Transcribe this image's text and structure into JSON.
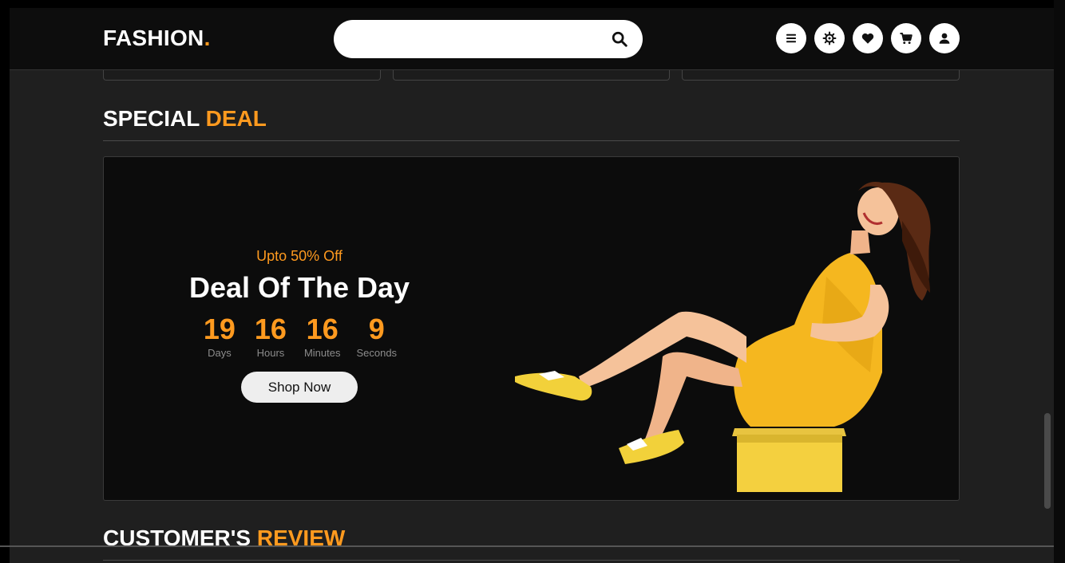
{
  "header": {
    "logo_text": "FASHION",
    "logo_dot": ".",
    "search_placeholder": "",
    "icons": [
      "menu-icon",
      "settings-icon",
      "heart-icon",
      "cart-icon",
      "user-icon"
    ]
  },
  "special_deal": {
    "title_main": "SPECIAL",
    "title_accent": "DEAL",
    "offer_text": "Upto 50% Off",
    "deal_title": "Deal Of The Day",
    "countdown": [
      {
        "value": "19",
        "label": "Days"
      },
      {
        "value": "16",
        "label": "Hours"
      },
      {
        "value": "16",
        "label": "Minutes"
      },
      {
        "value": "9",
        "label": "Seconds"
      }
    ],
    "button_label": "Shop Now"
  },
  "reviews": {
    "title_main": "CUSTOMER'S",
    "title_accent": "REVIEW"
  },
  "colors": {
    "accent": "#ff9a1f",
    "background": "#1f1f1f",
    "header_bg": "#0d0d0d",
    "banner_bg": "#0c0c0c"
  }
}
